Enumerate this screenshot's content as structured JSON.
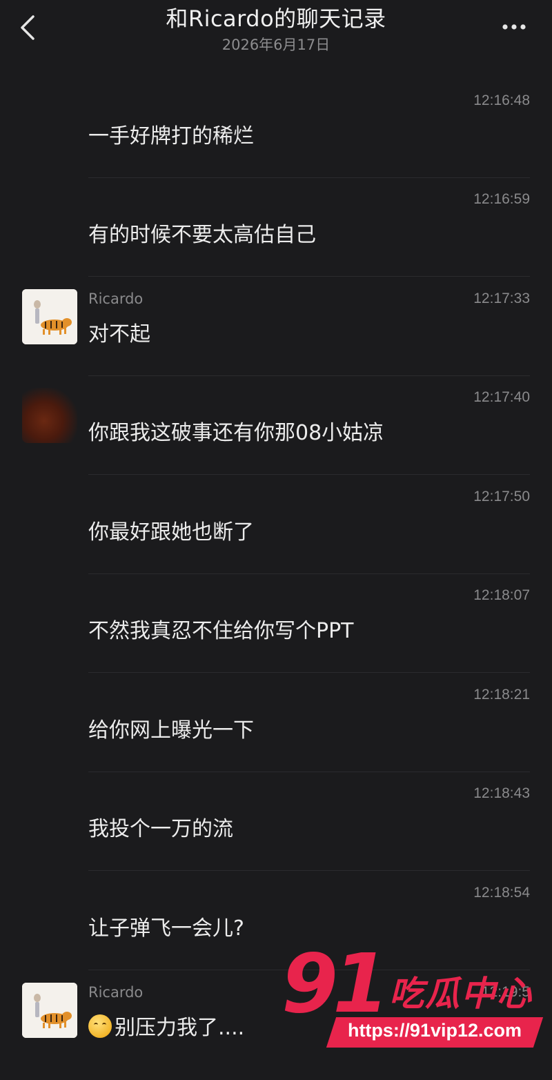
{
  "header": {
    "title": "和Ricardo的聊天记录",
    "date": "2026年6月17日"
  },
  "messages": [
    {
      "sender": "",
      "time": "12:16:48",
      "text": "一手好牌打的稀烂"
    },
    {
      "sender": "",
      "time": "12:16:59",
      "text": "有的时候不要太高估自己"
    },
    {
      "sender": "Ricardo",
      "time": "12:17:33",
      "text": "对不起"
    },
    {
      "sender": "",
      "time": "12:17:40",
      "text": "你跟我这破事还有你那08小姑凉"
    },
    {
      "sender": "",
      "time": "12:17:50",
      "text": "你最好跟她也断了"
    },
    {
      "sender": "",
      "time": "12:18:07",
      "text": "不然我真忍不住给你写个PPT"
    },
    {
      "sender": "",
      "time": "12:18:21",
      "text": "给你网上曝光一下"
    },
    {
      "sender": "",
      "time": "12:18:43",
      "text": "我投个一万的流"
    },
    {
      "sender": "",
      "time": "12:18:54",
      "text": "让子弹飞一会儿?"
    },
    {
      "sender": "Ricardo",
      "time": "12:19:5",
      "text": "别压力我了...."
    }
  ],
  "watermark": {
    "number": "91",
    "brand": "吃瓜中心",
    "url": "https://91vip12.com"
  },
  "colors": {
    "background": "#1b1b1d",
    "watermark": "#e8244c"
  }
}
